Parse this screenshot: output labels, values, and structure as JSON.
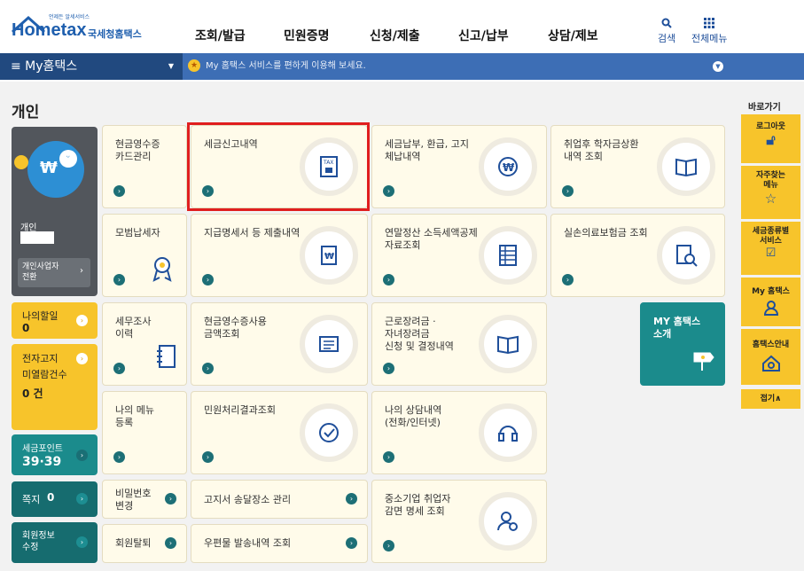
{
  "header": {
    "logo_tagline": "언제든 알세서비스",
    "logo_text": "Hometax",
    "logo_sub": "국세청홈택스",
    "nav": [
      "조회/발급",
      "민원증명",
      "신청/제출",
      "신고/납부",
      "상담/제보"
    ],
    "search_label": "검색",
    "all_menu_label": "전체메뉴"
  },
  "mybar": {
    "label": "≡  My홈택스",
    "message": "My 홈택스 서비스를 편하게 이용해 보세요."
  },
  "page_title": "개인",
  "profile": {
    "name": "개인",
    "convert_label": "개인사업자\n전환"
  },
  "sidebar": {
    "discount_label": "나의할일",
    "discount_count": "0",
    "notice_label": "전자고지\n미열람건수",
    "notice_count": "0 건",
    "points_label": "세금포인트",
    "points_value": "39·39",
    "memo_label": "쪽지",
    "memo_count": "0",
    "member_label": "회원정보\n수정"
  },
  "tiles": [
    {
      "label": "현금영수증\n카드관리"
    },
    {
      "label": "세금신고내역"
    },
    {
      "label": "세금납부, 환급, 고지\n체납내역"
    },
    {
      "label": "취업후 학자금상환\n내역 조회"
    },
    {
      "label": "모범납세자"
    },
    {
      "label": "지급명세서 등 제출내역"
    },
    {
      "label": "연말정산 소득세액공제\n자료조회"
    },
    {
      "label": "실손의료보험금 조회"
    },
    {
      "label": "세무조사\n이력"
    },
    {
      "label": "현금영수증사용\n금액조회"
    },
    {
      "label": "근로장려금 ·\n자녀장려금\n신청 및 결정내역"
    },
    {
      "label": "나의 메뉴\n등록"
    },
    {
      "label": "민원처리결과조회"
    },
    {
      "label": "나의 상담내역\n(전화/인터넷)"
    },
    {
      "label": "비밀번호\n변경"
    },
    {
      "label": "고지서 송달장소 관리"
    },
    {
      "label": "중소기업 취업자\n감면 명세 조회"
    },
    {
      "label": "회원탈퇴"
    },
    {
      "label": "우편물 발송내역 조회"
    }
  ],
  "intro_tile": {
    "label": "MY 홈택스\n소개"
  },
  "quick": {
    "title": "바로가기",
    "items": [
      "로그아웃",
      "자주찾는\n메뉴",
      "세금종류별\n서비스",
      "My 홈택스",
      "홈택스안내"
    ],
    "collapse": "접기∧"
  },
  "colors": {
    "accent": "#1f4f9a",
    "teal": "#1b7a80",
    "yellow": "#f7c42b",
    "highlight": "#e01e1e"
  }
}
